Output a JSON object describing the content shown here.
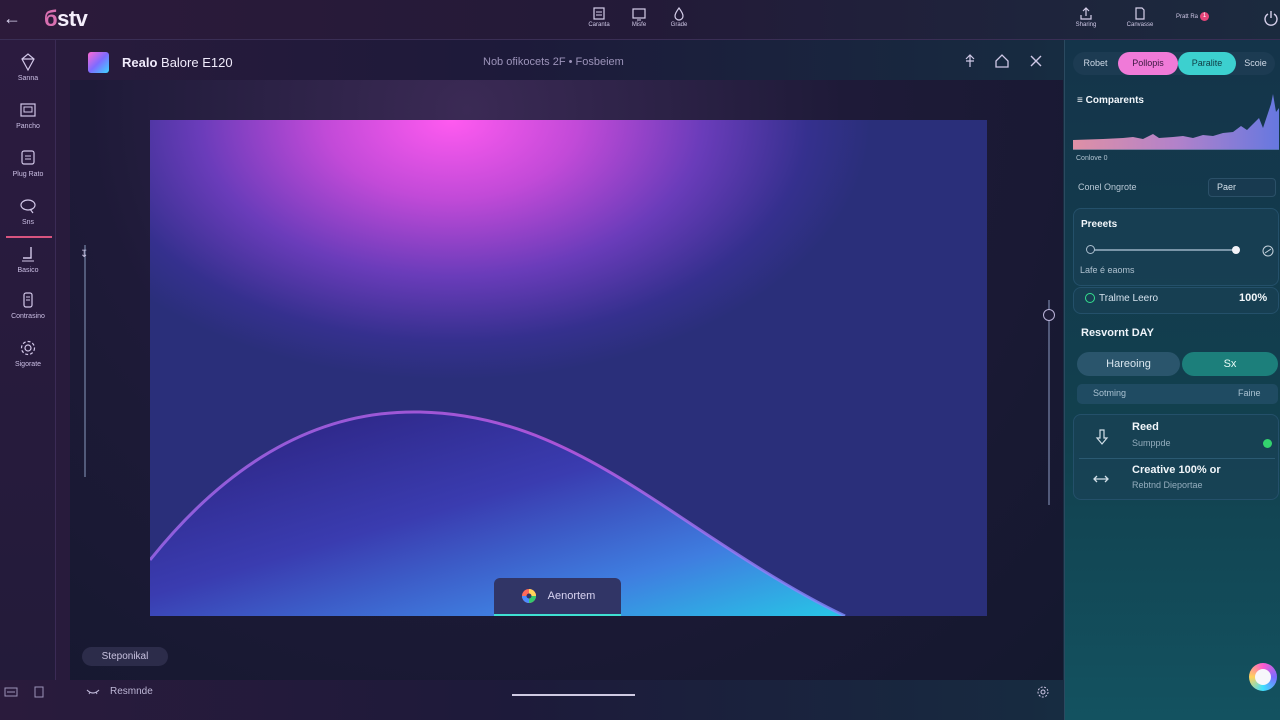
{
  "topbar": {
    "logo": "stv",
    "center_buttons": [
      {
        "label": "Caranta",
        "icon": "layers-icon"
      },
      {
        "label": "Misfe",
        "icon": "monitor-icon"
      },
      {
        "label": "Grade",
        "icon": "drop-icon"
      }
    ],
    "right_buttons": [
      {
        "label": "Sharing",
        "icon": "share-icon"
      },
      {
        "label": "Canvasse",
        "icon": "document-icon"
      },
      {
        "label": "Pratt Ra",
        "badge": "1"
      }
    ]
  },
  "sidebar": {
    "items": [
      {
        "label": "Sanna",
        "icon": "diamond-icon"
      },
      {
        "label": "Pancho",
        "icon": "image-icon"
      },
      {
        "label": "Plug Rato",
        "icon": "stack-icon"
      },
      {
        "label": "Sns",
        "icon": "lasso-icon"
      },
      {
        "label": "Basico",
        "icon": "pen-icon",
        "active": true
      },
      {
        "label": "Contrasino",
        "icon": "jar-icon"
      },
      {
        "label": "Sigorate",
        "icon": "gear-icon"
      }
    ]
  },
  "editor": {
    "doc_title_bold": "Realo",
    "doc_title_rest": " Balore E120",
    "doc_subtitle": "Nob ofikocets 2F • Fosbeiem",
    "float_button": "Aenortem",
    "pill": "Steponikal",
    "bottom_label": "Resmnde"
  },
  "panel": {
    "tabs": [
      "Robet",
      "Pollopis",
      "Paralite",
      "Scoie"
    ],
    "components_title": "Comparents",
    "components_sub": "Conlove 0",
    "dropdown_label": "Conel Ongrote",
    "dropdown_value": "Paer",
    "presets_title": "Preeets",
    "presets_sub": "Lafe é eaoms",
    "presets_slider_value": 1.0,
    "timeline_label": "Tralme Leero",
    "timeline_value": "100%",
    "section_title": "Resvornt DAY",
    "segments": [
      "Hareoing",
      "Sx"
    ],
    "setting_label": "Sotming",
    "setting_value": "Faine",
    "items": [
      {
        "title": "Reed",
        "subtitle": "Sumppde",
        "icon": "download-icon"
      },
      {
        "title": "Creative 100% or",
        "subtitle": "Rebtnd Dieportae",
        "icon": "arrows-horizontal-icon"
      }
    ]
  },
  "colors": {
    "accent_pink": "#f07ad8",
    "accent_teal": "#3cd0cf",
    "status_green": "#33d36e"
  }
}
